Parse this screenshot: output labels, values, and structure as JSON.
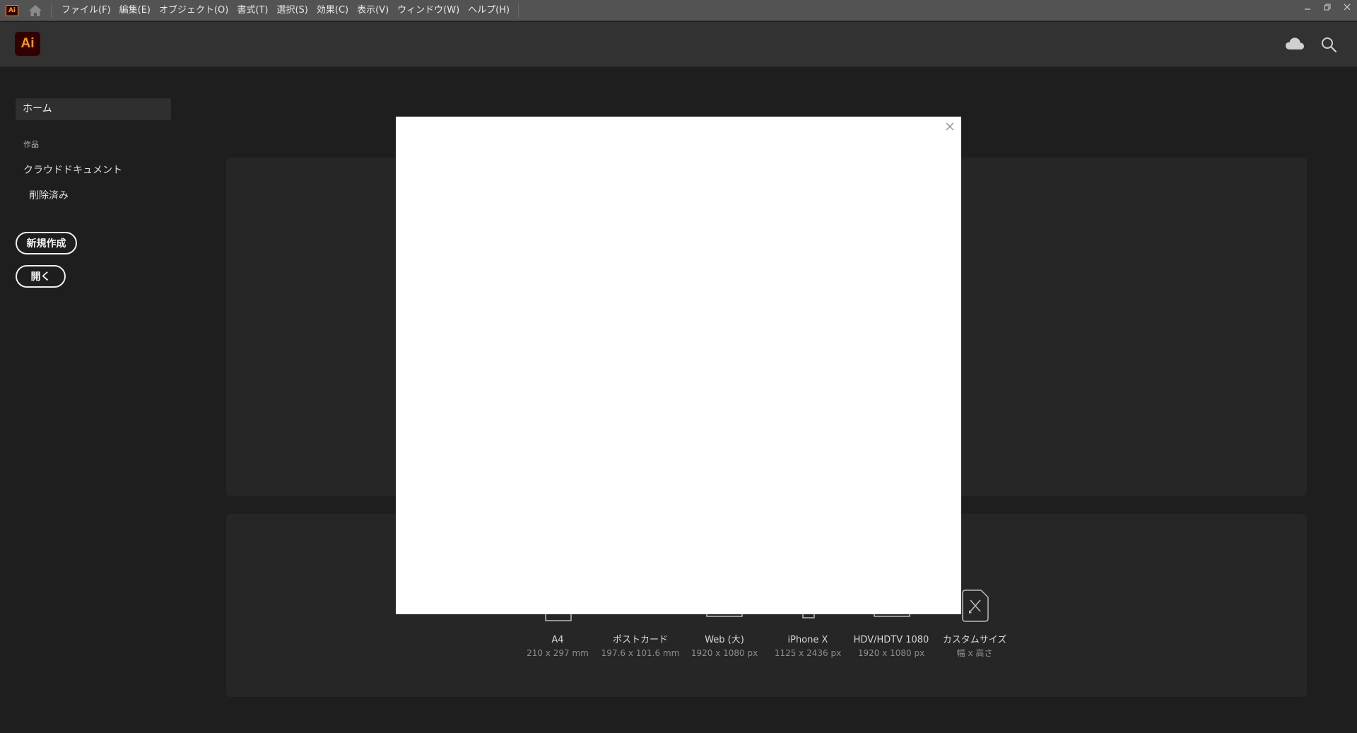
{
  "menubar": {
    "app_badge": "Ai",
    "items": [
      "ファイル(F)",
      "編集(E)",
      "オブジェクト(O)",
      "書式(T)",
      "選択(S)",
      "効果(C)",
      "表示(V)",
      "ウィンドウ(W)",
      "ヘルプ(H)"
    ]
  },
  "header": {
    "logo": "Ai"
  },
  "sidebar": {
    "home": "ホーム",
    "section": "作品",
    "cloud_docs": "クラウドドキュメント",
    "deleted": "削除済み",
    "new_button": "新規作成",
    "open_button": "開く"
  },
  "presets": [
    {
      "name": "A4",
      "size": "210 x 297 mm"
    },
    {
      "name": "ポストカード",
      "size": "197.6 x 101.6 mm"
    },
    {
      "name": "Web (大)",
      "size": "1920 x 1080 px"
    },
    {
      "name": "iPhone X",
      "size": "1125 x 2436 px"
    },
    {
      "name": "HDV/HDTV 1080",
      "size": "1920 x 1080 px"
    },
    {
      "name": "カスタムサイズ",
      "size": "幅 x 高さ"
    }
  ],
  "colors": {
    "accent": "#ff9a00",
    "logo_bg": "#330000",
    "modal_bg": "#ffffff"
  }
}
